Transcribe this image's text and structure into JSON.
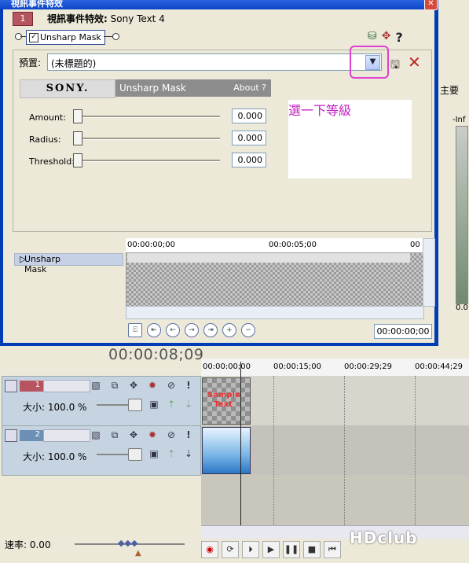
{
  "dialog": {
    "title": "視訊事件特效",
    "chain_number": "1",
    "chain_title_bold": "視訊事件特效:",
    "chain_title_rest": " Sony Text 4",
    "plugin_chip": "Unsharp Mask",
    "plugin_checked": "✓",
    "help_glyph": "?",
    "close_glyph": "✕"
  },
  "preset": {
    "label": "預置:",
    "value": "(未標題的)"
  },
  "plugin_header": {
    "brand": "SONY.",
    "name": "Unsharp Mask",
    "about": "About ?"
  },
  "params": [
    {
      "label": "Amount:",
      "value": "0.000"
    },
    {
      "label": "Radius:",
      "value": "0.000"
    },
    {
      "label": "Threshold:",
      "value": "0.000"
    }
  ],
  "annotation": "選一下等級",
  "keyframes": {
    "row_label": "Unsharp Mask",
    "ruler": [
      "00:00:00;00",
      "00:00:05;00",
      "00"
    ],
    "time": "00:00:00;00"
  },
  "editor": {
    "right_strip_labels": [
      "主要",
      "-Inf",
      "0.0"
    ],
    "big_time": "00:00:08;09",
    "ruler": [
      "00:00:00;00",
      "00:00:15;00",
      "00:00:29;29",
      "00:00:44;29"
    ],
    "tracks": [
      {
        "number": "1",
        "size": "大小: 100.0 %",
        "clip_text": "Sample Text"
      },
      {
        "number": "2",
        "size": "大小: 100.0 %",
        "clip_text": ""
      }
    ],
    "rate": "速率: 0.00",
    "watermark": "HDclub"
  }
}
